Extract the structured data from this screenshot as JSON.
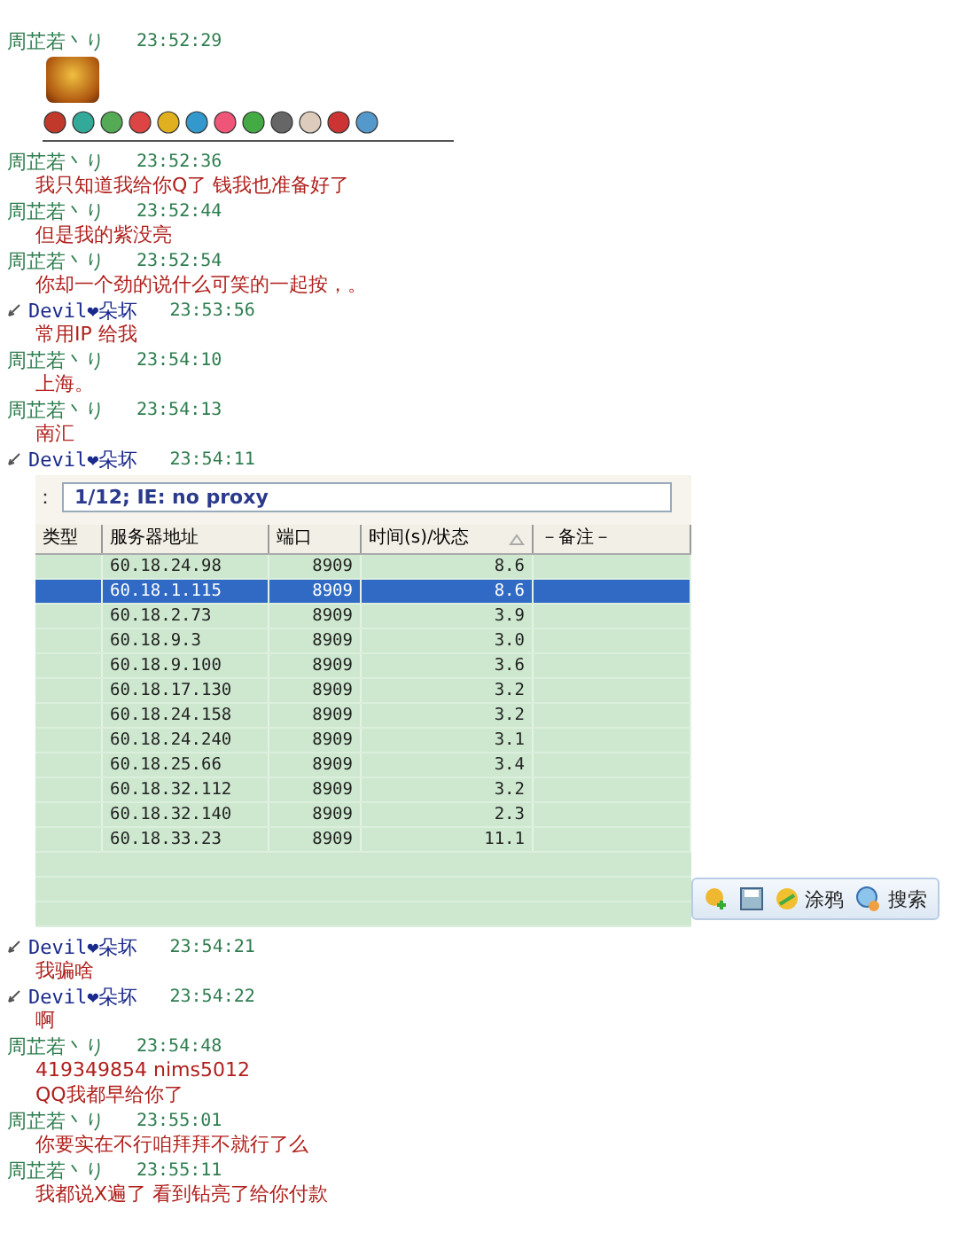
{
  "messages": [
    {
      "kind": "sticker",
      "sender": {
        "kind": "self",
        "name": "周芷若丶り"
      },
      "time": "23:52:29"
    },
    {
      "kind": "text",
      "sender": {
        "kind": "self",
        "name": "周芷若丶り"
      },
      "time": "23:52:36",
      "lines": [
        "我只知道我给你Q了 钱我也准备好了"
      ]
    },
    {
      "kind": "text",
      "sender": {
        "kind": "self",
        "name": "周芷若丶り"
      },
      "time": "23:52:44",
      "lines": [
        "但是我的紫没亮"
      ]
    },
    {
      "kind": "text",
      "sender": {
        "kind": "self",
        "name": "周芷若丶り"
      },
      "time": "23:52:54",
      "lines": [
        "你却一个劲的说什么可笑的一起按，。"
      ]
    },
    {
      "kind": "text",
      "sender": {
        "kind": "other",
        "name": "Devil❤朵坏"
      },
      "time": "23:53:56",
      "lines": [
        "常用IP 给我"
      ]
    },
    {
      "kind": "text",
      "sender": {
        "kind": "self",
        "name": "周芷若丶り"
      },
      "time": "23:54:10",
      "lines": [
        "上海。"
      ]
    },
    {
      "kind": "text",
      "sender": {
        "kind": "self",
        "name": "周芷若丶り"
      },
      "time": "23:54:13",
      "lines": [
        "南汇"
      ]
    },
    {
      "kind": "screenshot",
      "sender": {
        "kind": "other",
        "name": "Devil❤朵坏"
      },
      "time": "23:54:11",
      "screenshot": {
        "prefix": "：",
        "status": "1/12;   IE: no proxy",
        "columns": [
          "类型",
          "服务器地址",
          "端口",
          "时间(s)/状态",
          "－备注－"
        ],
        "rows": [
          {
            "address": "60.18.24.98",
            "port": "8909",
            "time": "8.6",
            "selected": false
          },
          {
            "address": "60.18.1.115",
            "port": "8909",
            "time": "8.6",
            "selected": true
          },
          {
            "address": "60.18.2.73",
            "port": "8909",
            "time": "3.9",
            "selected": false
          },
          {
            "address": "60.18.9.3",
            "port": "8909",
            "time": "3.0",
            "selected": false
          },
          {
            "address": "60.18.9.100",
            "port": "8909",
            "time": "3.6",
            "selected": false
          },
          {
            "address": "60.18.17.130",
            "port": "8909",
            "time": "3.2",
            "selected": false
          },
          {
            "address": "60.18.24.158",
            "port": "8909",
            "time": "3.2",
            "selected": false
          },
          {
            "address": "60.18.24.240",
            "port": "8909",
            "time": "3.1",
            "selected": false
          },
          {
            "address": "60.18.25.66",
            "port": "8909",
            "time": "3.4",
            "selected": false
          },
          {
            "address": "60.18.32.112",
            "port": "8909",
            "time": "3.2",
            "selected": false
          },
          {
            "address": "60.18.32.140",
            "port": "8909",
            "time": "2.3",
            "selected": false
          },
          {
            "address": "60.18.33.23",
            "port": "8909",
            "time": "11.1",
            "selected": false
          }
        ]
      }
    },
    {
      "kind": "text",
      "sender": {
        "kind": "other",
        "name": "Devil❤朵坏"
      },
      "time": "23:54:21",
      "lines": [
        "我骗啥"
      ]
    },
    {
      "kind": "text",
      "sender": {
        "kind": "other",
        "name": "Devil❤朵坏"
      },
      "time": "23:54:22",
      "lines": [
        "啊"
      ]
    },
    {
      "kind": "text",
      "sender": {
        "kind": "self",
        "name": "周芷若丶り"
      },
      "time": "23:54:48",
      "lines": [
        "419349854 nims5012",
        "QQ我都早给你了"
      ]
    },
    {
      "kind": "text",
      "sender": {
        "kind": "self",
        "name": "周芷若丶り"
      },
      "time": "23:55:01",
      "lines": [
        "你要实在不行咱拜拜不就行了么"
      ]
    },
    {
      "kind": "text",
      "sender": {
        "kind": "self",
        "name": "周芷若丶り"
      },
      "time": "23:55:11",
      "lines": [
        "我都说X遍了  看到钻亮了给你付款"
      ]
    }
  ],
  "toolbar": [
    {
      "kind": "add"
    },
    {
      "kind": "save"
    },
    {
      "kind": "doodle",
      "label": "涂鸦"
    },
    {
      "kind": "search",
      "label": "搜索"
    }
  ]
}
